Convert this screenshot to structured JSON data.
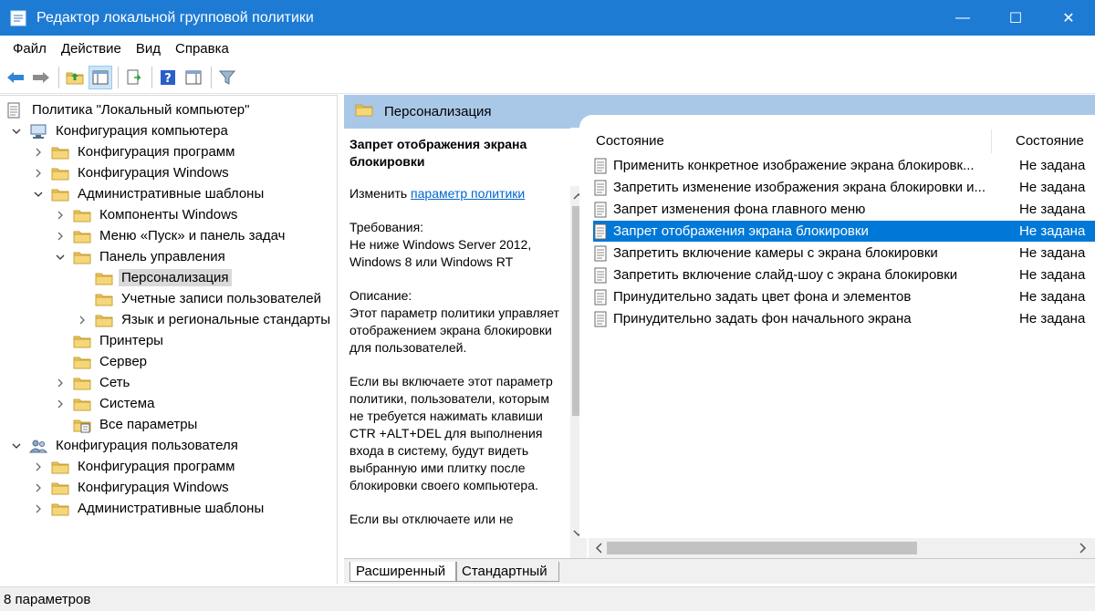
{
  "window": {
    "title": "Редактор локальной групповой политики",
    "minimize": "—",
    "maximize": "☐",
    "close": "✕"
  },
  "menu": [
    "Файл",
    "Действие",
    "Вид",
    "Справка"
  ],
  "tree": {
    "root": "Политика \"Локальный компьютер\"",
    "computer": "Конфигурация компьютера",
    "comp_programs": "Конфигурация программ",
    "comp_windows": "Конфигурация Windows",
    "comp_admin": "Административные шаблоны",
    "win_components": "Компоненты Windows",
    "start_menu": "Меню «Пуск» и панель задач",
    "control_panel": "Панель управления",
    "personalization": "Персонализация",
    "user_accounts": "Учетные записи пользователей",
    "regional": "Язык и региональные стандарты",
    "printers": "Принтеры",
    "server": "Сервер",
    "network": "Сеть",
    "system": "Система",
    "all_params": "Все параметры",
    "user": "Конфигурация пользователя",
    "user_programs": "Конфигурация программ",
    "user_windows": "Конфигурация Windows",
    "user_admin": "Административные шаблоны"
  },
  "right": {
    "header": "Персонализация",
    "desc_title": "Запрет отображения экрана блокировки",
    "edit_prefix": "Изменить ",
    "edit_link": "параметр политики",
    "req_label": "Требования:",
    "req_text": "Не ниже Windows Server 2012, Windows 8 или Windows RT",
    "desc_label": "Описание:",
    "desc_text": "Этот параметр политики управляет отображением экрана блокировки для пользователей.",
    "desc_text2": "Если вы включаете этот параметр политики, пользователи, которым не требуется нажимать клавиши CTR +ALT+DEL для выполнения входа в систему, будут видеть выбранную ими плитку после блокировки своего компьютера.",
    "desc_text3": "Если вы отключаете или не",
    "col_name": "Состояние",
    "col_state": "Состояние",
    "rows": [
      {
        "name": "Применить конкретное изображение экрана блокировк...",
        "state": "Не задана"
      },
      {
        "name": "Запретить изменение изображения экрана блокировки и...",
        "state": "Не задана"
      },
      {
        "name": "Запрет изменения фона главного меню",
        "state": "Не задана"
      },
      {
        "name": "Запрет отображения экрана блокировки",
        "state": "Не задана"
      },
      {
        "name": "Запретить включение камеры с экрана блокировки",
        "state": "Не задана"
      },
      {
        "name": "Запретить включение слайд-шоу с экрана блокировки",
        "state": "Не задана"
      },
      {
        "name": "Принудительно задать цвет фона и элементов",
        "state": "Не задана"
      },
      {
        "name": "Принудительно задать фон начального экрана",
        "state": "Не задана"
      }
    ]
  },
  "tabs": {
    "extended": "Расширенный",
    "standard": "Стандартный"
  },
  "status": "8 параметров",
  "colors": {
    "titlebar": "#1e7bd4",
    "header": "#a9c8e8",
    "selection": "#0078d7",
    "folder": "#e8c45c"
  }
}
